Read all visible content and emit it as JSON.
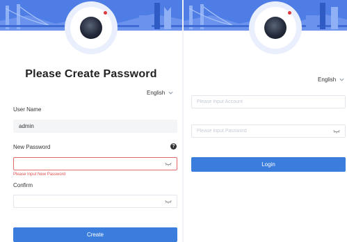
{
  "create_password": {
    "title": "Please Create Password",
    "language": "English",
    "username_label": "User Name",
    "username_value": "admin",
    "new_password_label": "New Password",
    "new_password_error": "Please Input New Password",
    "confirm_label": "Confirm",
    "create_button": "Create"
  },
  "login": {
    "language": "English",
    "account_placeholder": "Please Input Account",
    "password_placeholder": "Please Input Password",
    "login_button": "Login"
  },
  "colors": {
    "banner": "#4f7de6",
    "primary_button": "#3b7ddd",
    "error": "#e05050"
  },
  "icons": [
    "camera-icon",
    "chevron-down-icon",
    "eye-icon",
    "help-icon"
  ]
}
